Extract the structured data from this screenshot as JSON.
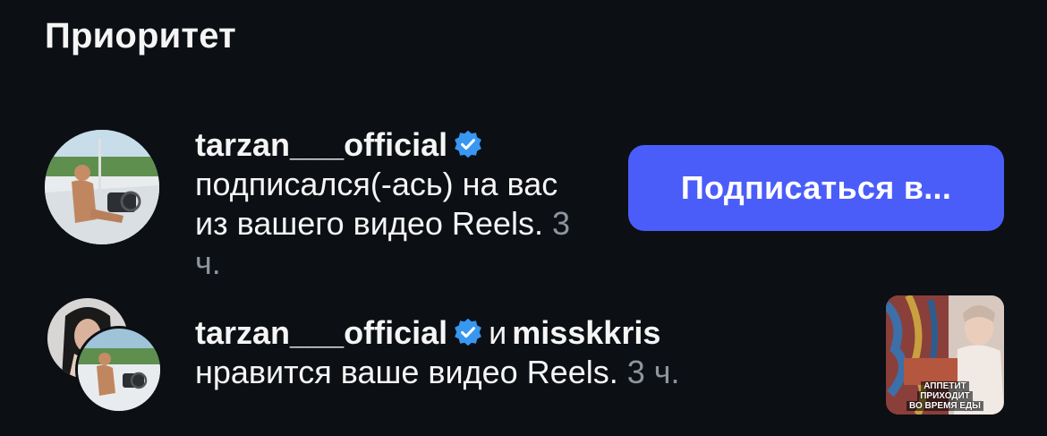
{
  "section": {
    "title": "Приоритет"
  },
  "notifications": [
    {
      "username": "tarzan___official",
      "verified": true,
      "text": "подписался(-ась) на вас из вашего видео Reels.",
      "time": "3 ч.",
      "button_label": "Подписаться в..."
    },
    {
      "username": "tarzan___official",
      "verified": true,
      "conjunction": "и",
      "second_username": "misskkris",
      "text": "нравится ваше видео Reels.",
      "time": "3 ч.",
      "thumbnail_caption": [
        "АППЕТИТ",
        "ПРИХОДИТ",
        "ВО ВРЕМЯ ЕДЫ"
      ]
    }
  ],
  "colors": {
    "background": "#0c0f14",
    "accent_button": "#4a5df9",
    "verified_badge": "#3897f0",
    "timestamp": "#8e959e"
  },
  "icons": {
    "verified": "verified-badge-icon"
  }
}
